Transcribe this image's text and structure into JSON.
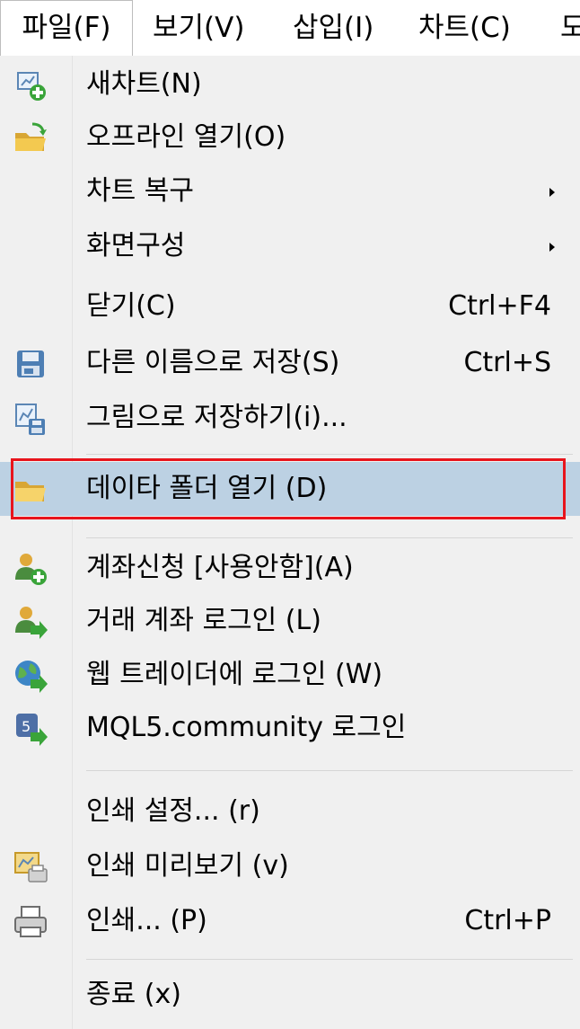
{
  "menubar": {
    "items": [
      {
        "label": "파일(F)",
        "active": true
      },
      {
        "label": "보기(V)"
      },
      {
        "label": "삽입(I)"
      },
      {
        "label": "차트(C)"
      },
      {
        "label": "도"
      }
    ]
  },
  "menu": {
    "items": [
      {
        "label": "새차트(N)",
        "shortcut": "",
        "icon": "new-chart-icon"
      },
      {
        "label": "오프라인 열기(O)",
        "shortcut": "",
        "icon": "open-offline-folder-icon"
      },
      {
        "label": "차트 복구",
        "shortcut": "",
        "submenu": true
      },
      {
        "label": "화면구성",
        "shortcut": "",
        "submenu": true
      },
      {
        "label": "닫기(C)",
        "shortcut": "Ctrl+F4"
      },
      {
        "label": "다른 이름으로 저장(S)",
        "shortcut": "Ctrl+S",
        "icon": "save-disk-icon"
      },
      {
        "label": "그림으로 저장하기(i)...",
        "shortcut": "",
        "icon": "save-picture-icon"
      },
      {
        "label": "데이타 폴더 열기 (D)",
        "shortcut": "",
        "icon": "open-data-folder-icon",
        "highlighted": true
      },
      {
        "label": "계좌신청 [사용안함](A)",
        "shortcut": "",
        "icon": "open-account-icon"
      },
      {
        "label": "거래 계좌 로그인 (L)",
        "shortcut": "",
        "icon": "trade-login-icon"
      },
      {
        "label": "웹 트레이더에 로그인 (W)",
        "shortcut": "",
        "icon": "web-trader-login-icon"
      },
      {
        "label": "MQL5.community 로그인",
        "shortcut": "",
        "icon": "mql5-login-icon"
      },
      {
        "label": "인쇄 설정... (r)",
        "shortcut": ""
      },
      {
        "label": "인쇄 미리보기 (v)",
        "shortcut": "",
        "icon": "print-preview-icon"
      },
      {
        "label": "인쇄... (P)",
        "shortcut": "Ctrl+P",
        "icon": "printer-icon"
      },
      {
        "label": "종료 (x)",
        "shortcut": ""
      }
    ]
  },
  "colors": {
    "highlight_bg": "#bcd1e3",
    "highlight_border": "#e8141c",
    "menu_bg": "#f0f0f0"
  }
}
